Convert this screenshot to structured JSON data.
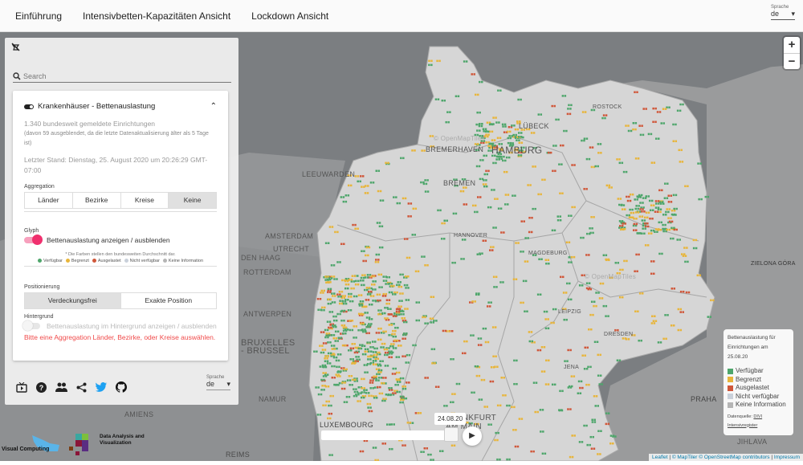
{
  "nav": {
    "items": [
      "Einführung",
      "Intensivbetten-Kapazitäten Ansicht",
      "Lockdown Ansicht"
    ],
    "language_label": "Sprache",
    "language_value": "de"
  },
  "panel": {
    "search_placeholder": "Search",
    "layer_title": "Krankenhäuser - Bettenauslastung",
    "count_text": "1.340 bundesweit gemeldete Einrichtungen",
    "hidden_note": "(davon 59 ausgeblendet, da die letzte Datenaktualisierung älter als 5 Tage ist)",
    "last_update": "Letzter Stand: Dienstag, 25. August 2020 um 20:26:29 GMT-07:00",
    "aggregation_label": "Aggregation",
    "aggregation_options": [
      "Länder",
      "Bezirke",
      "Kreise",
      "Keine"
    ],
    "aggregation_selected": "Keine",
    "glyph_label": "Glyph",
    "glyph_toggle_label": "Bettenauslastung anzeigen / ausblenden",
    "glyph_on": true,
    "colors_note": "* Die Farben stellen den bundesweiten Durchschnitt dar.",
    "status_legend": [
      {
        "label": "Verfügbar",
        "color": "#4ea66b"
      },
      {
        "label": "Begrenzt",
        "color": "#e8b53a"
      },
      {
        "label": "Ausgelastet",
        "color": "#d0573a"
      },
      {
        "label": "Nicht verfügbar",
        "color": "#c9d0da"
      },
      {
        "label": "Keine Information",
        "color": "#b5b5b5"
      }
    ],
    "positioning_label": "Positionierung",
    "positioning_options": [
      "Verdeckungsfrei",
      "Exakte Position"
    ],
    "positioning_selected": "Verdeckungsfrei",
    "background_label": "Hintergrund",
    "background_toggle_label": "Bettenauslastung im Hintergrund anzeigen / ausblenden",
    "background_on": false,
    "warning": "Bitte eine Aggregation Länder, Bezirke, oder Kreise auswählen.",
    "language_label": "Sprache",
    "language_value": "de"
  },
  "map": {
    "cities": [
      "AMSTERDAM",
      "UTRECHT",
      "DEN HAAG",
      "ROTTERDAM",
      "ANTWERPEN",
      "BRUXELLES",
      "- BRUSSEL",
      "NAMUR",
      "LEEUWARDEN",
      "AMIENS",
      "REIMS",
      "LUXEMBOURG",
      "PRAHA",
      "JIHLAVA",
      "BREMERHAVEN",
      "HAMBURG",
      "BREMEN",
      "LÜBECK",
      "ROSTOCK",
      "HANNOVER",
      "MAGDEBURG",
      "LEIPZIG",
      "DRESDEN",
      "JENA",
      "FRANKFURT AM MAIN",
      "ZIELONA GÓRA"
    ],
    "tiles_credit": "© OpenMapTiles",
    "zoom_in": "+",
    "zoom_out": "−"
  },
  "legend": {
    "title": "Bettenauslastung für Einrichtungen am",
    "date": "25.08.20",
    "source_label": "Datenquelle:",
    "source_link": "DIVI",
    "source_link2": "Intensivregister"
  },
  "timeline": {
    "date": "24.08.20",
    "progress": 0.92
  },
  "logos": {
    "left": "Visual Computing",
    "right": "Data Analysis and Visualization"
  },
  "attribution": {
    "leaflet": "Leaflet",
    "maptiler": "© MapTiler",
    "osm": "© OpenStreetMap contributors",
    "impressum": "Impressum"
  }
}
